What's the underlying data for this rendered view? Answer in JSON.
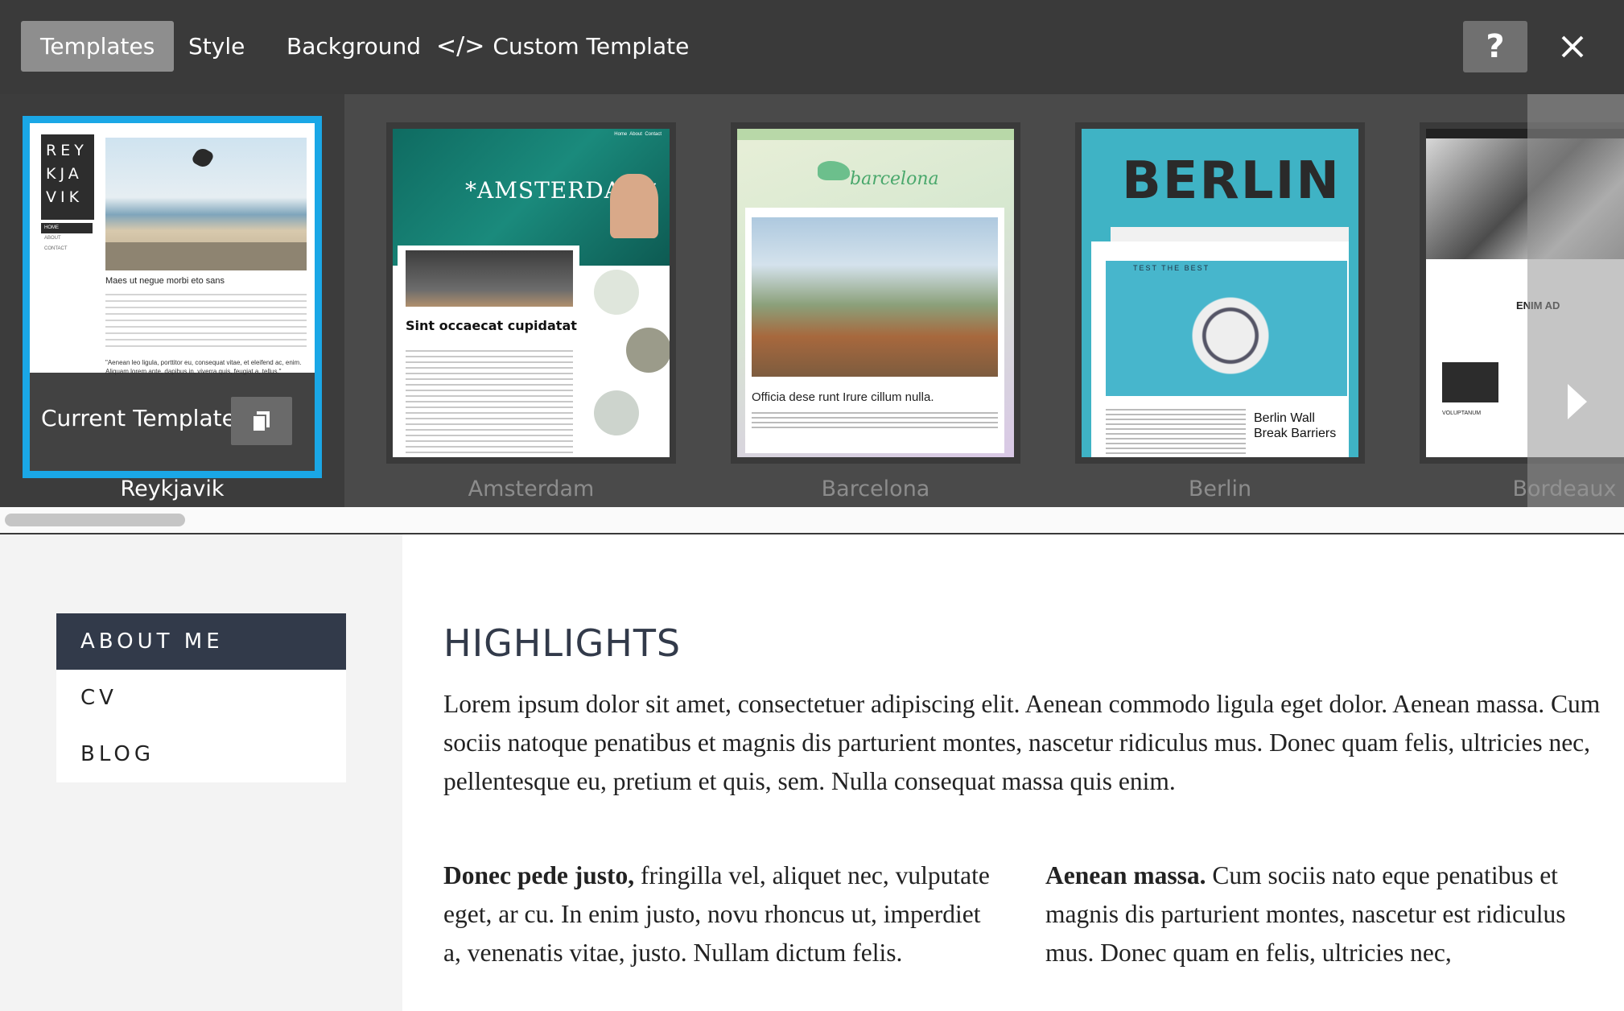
{
  "toolbar": {
    "tabs": [
      {
        "label": "Templates"
      },
      {
        "label": "Style"
      },
      {
        "label": "Background"
      },
      {
        "label": "Custom Template"
      }
    ],
    "help_label": "?"
  },
  "templates": {
    "current_overlay_label": "Current Template",
    "cards": [
      {
        "name": "Reykjavik",
        "selected": true
      },
      {
        "name": "Amsterdam",
        "selected": false
      },
      {
        "name": "Barcelona",
        "selected": false
      },
      {
        "name": "Berlin",
        "selected": false
      },
      {
        "name": "Bordeaux",
        "selected": false
      }
    ],
    "reykjavik_thumb": {
      "logo": [
        "REY",
        "KJA",
        "VIK"
      ],
      "heading": "Maes ut negue morbi eto sans",
      "quote": "\"Aenean leo ligula, porttitor eu, consequat vitae, et eleifend ac, enim. Aliquam lorem ante, dapibus in, viverra quis, feugiat a, tellus.\"",
      "nav": [
        "HOME",
        "ABOUT",
        "CONTACT"
      ]
    },
    "amsterdam_thumb": {
      "title": "*AMSTERDAM*",
      "heading": "Sint occaecat cupidatat",
      "nav": [
        "Home",
        "About",
        "Contact"
      ]
    },
    "barcelona_thumb": {
      "title": "barcelona",
      "caption": "Officia dese runt Irure cillum nulla."
    },
    "berlin_thumb": {
      "title": "BERLIN",
      "inner_heading": "TEST THE BEST",
      "caption": "Berlin Wall Break Barriers"
    },
    "bordeaux_thumb": {
      "side_text": "ENIM AD",
      "caption": "VOLUPTANUM"
    }
  },
  "preview": {
    "nav": [
      {
        "label": "ABOUT ME"
      },
      {
        "label": "CV"
      },
      {
        "label": "BLOG"
      }
    ],
    "heading": "HIGHLIGHTS",
    "intro": "Lorem ipsum dolor sit amet, consectetuer adipiscing elit. Aenean commodo ligula eget dolor. Aenean massa. Cum sociis natoque penatibus et magnis dis parturient montes, nascetur ridiculus mus. Donec quam felis, ultricies nec, pellentesque eu, pretium et quis, sem.  Nulla consequat massa quis enim.",
    "col1_bold": "Donec pede justo,",
    "col1_text": " fringilla vel, aliquet nec, vulputate eget, ar cu. In enim justo, novu rhoncus ut, imperdiet a, venenatis vitae, justo. Nullam dictum felis.",
    "col2_bold": "Aenean massa.",
    "col2_text": " Cum sociis nato eque penatibus et magnis dis parturient montes, nascetur est ridiculus mus. Donec quam en felis, ultricies nec,"
  },
  "colors": {
    "toolbar_bg": "#3a3a3a",
    "active_tab_bg": "#8e8e8e",
    "selection_border": "#1aa7e6",
    "nav_active_bg": "#323a4a"
  }
}
